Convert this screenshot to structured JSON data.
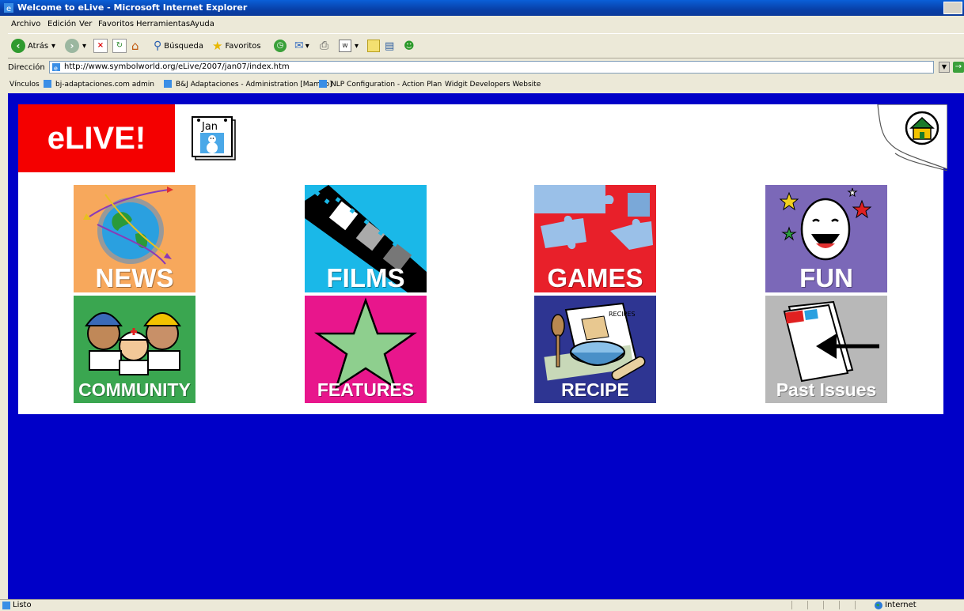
{
  "window": {
    "title": "Welcome to eLive - Microsoft Internet Explorer"
  },
  "menu": [
    "Archivo",
    "Edición",
    "Ver",
    "Favoritos",
    "Herramientas",
    "Ayuda"
  ],
  "toolbar": {
    "back_label": "Atrás",
    "search_label": "Búsqueda",
    "favorites_label": "Favoritos"
  },
  "address": {
    "label": "Dirección",
    "url": "http://www.symbolworld.org/eLive/2007/jan07/index.htm"
  },
  "links": {
    "label": "Vínculos",
    "items": [
      "bj-adaptaciones.com admin",
      "B&J Adaptaciones - Administration [Mambo]",
      "NLP Configuration - Action Plan",
      "Widgit Developers Website"
    ]
  },
  "page": {
    "logo": "eLIVE!",
    "calendar_month": "Jan",
    "tiles": [
      {
        "label": "NEWS",
        "color": "#f7a85c"
      },
      {
        "label": "FILMS",
        "color": "#1ab8e8"
      },
      {
        "label": "GAMES",
        "color": "#e8202a"
      },
      {
        "label": "FUN",
        "color": "#7b68b8"
      },
      {
        "label": "COMMUNITY",
        "color": "#3aa650"
      },
      {
        "label": "FEATURES",
        "color": "#e8168c"
      },
      {
        "label": "RECIPE",
        "color": "#2e3592"
      },
      {
        "label": "Past Issues",
        "color": "#b8b8b8"
      }
    ],
    "background_color": "#0000c8"
  },
  "status": {
    "text": "Listo",
    "zone": "Internet"
  }
}
